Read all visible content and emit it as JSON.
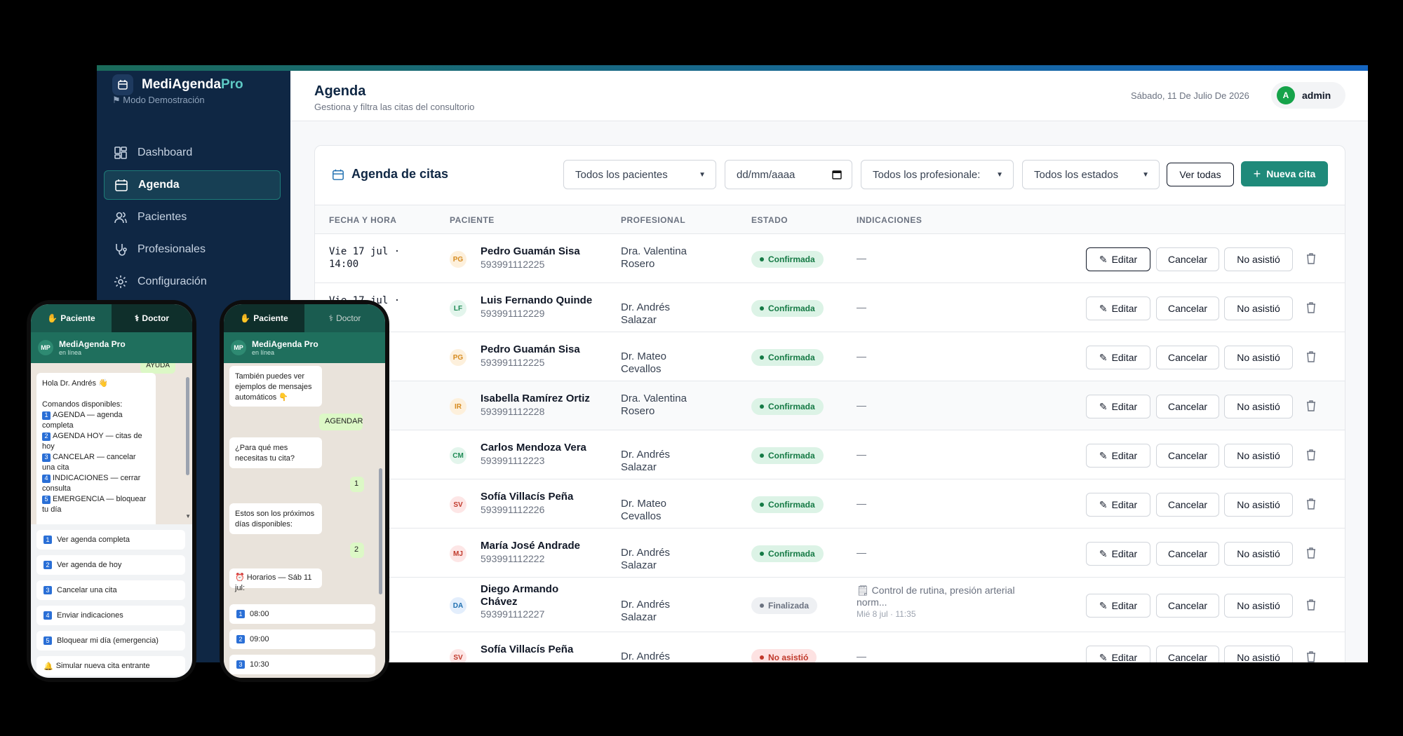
{
  "app": {
    "name": "MediAgenda",
    "name_suffix": "Pro",
    "mode": "Modo Demostración"
  },
  "sidebar": {
    "items": [
      {
        "label": "Dashboard",
        "icon": "dashboard-icon"
      },
      {
        "label": "Agenda",
        "icon": "calendar-icon",
        "active": true
      },
      {
        "label": "Pacientes",
        "icon": "users-icon"
      },
      {
        "label": "Profesionales",
        "icon": "stethoscope-icon"
      },
      {
        "label": "Configuración",
        "icon": "gear-icon"
      }
    ]
  },
  "header": {
    "title": "Agenda",
    "subtitle": "Gestiona y filtra las citas del consultorio",
    "date": "Sábado, 11 De Julio De 2026",
    "user_initial": "A",
    "user_name": "admin"
  },
  "card": {
    "title": "Agenda de citas",
    "filters": {
      "patients": "Todos los pacientes",
      "date_placeholder": "dd/mm/aaaa",
      "professionals": "Todos los profesionale:",
      "states": "Todos los estados"
    },
    "view_all": "Ver todas",
    "new_appointment": "Nueva cita",
    "columns": [
      "FECHA Y HORA",
      "PACIENTE",
      "PROFESIONAL",
      "ESTADO",
      "INDICACIONES"
    ],
    "actions": {
      "edit": "Editar",
      "cancel": "Cancelar",
      "no_show": "No asistió"
    },
    "rows": [
      {
        "date": "Vie 17 jul ·\n14:00",
        "initials": "PG",
        "name": "Pedro Guamán Sisa",
        "phone": "593991112225",
        "professional": "Dra. Valentina Rosero",
        "status": "Confirmada",
        "indication": "—"
      },
      {
        "date": "Vie 17 jul ·",
        "initials": "LF",
        "name": "Luis Fernando Quinde",
        "phone": "593991112229",
        "professional": "Dr. Andrés Salazar",
        "status": "Confirmada",
        "indication": "—"
      },
      {
        "date": "·",
        "initials": "PG",
        "name": "Pedro Guamán Sisa",
        "phone": "593991112225",
        "professional": "Dr. Mateo Cevallos",
        "status": "Confirmada",
        "indication": "—"
      },
      {
        "date": "·",
        "initials": "IR",
        "name": "Isabella Ramírez Ortiz",
        "phone": "593991112228",
        "professional": "Dra. Valentina Rosero",
        "status": "Confirmada",
        "indication": "—"
      },
      {
        "date": "·",
        "initials": "CM",
        "name": "Carlos Mendoza Vera",
        "phone": "593991112223",
        "professional": "Dr. Andrés Salazar",
        "status": "Confirmada",
        "indication": "—"
      },
      {
        "date": "·",
        "initials": "SV",
        "name": "Sofía Villacís Peña",
        "phone": "593991112226",
        "professional": "Dr. Mateo Cevallos",
        "status": "Confirmada",
        "indication": "—"
      },
      {
        "date": "·",
        "initials": "MJ",
        "name": "María José Andrade",
        "phone": "593991112222",
        "professional": "Dr. Andrés Salazar",
        "status": "Confirmada",
        "indication": "—"
      },
      {
        "date": "·",
        "initials": "DA",
        "name": "Diego Armando Chávez",
        "phone": "593991112227",
        "professional": "Dr. Andrés Salazar",
        "status": "Finalizada",
        "indication": "Control de rutina, presión arterial norm...",
        "indication_date": "Mié 8 jul · 11:35"
      },
      {
        "date": "·",
        "initials": "SV",
        "name": "Sofía Villacís Peña",
        "phone": "",
        "professional": "Dr. Andrés Salazar",
        "status": "No asistió",
        "indication": "—"
      }
    ]
  },
  "phone1": {
    "tab_patient": "Paciente",
    "tab_doctor": "Doctor",
    "contact": "MediAgenda Pro",
    "contact_initials": "MP",
    "contact_status": "en línea",
    "cut_top": "AYUDA",
    "message": {
      "greeting": "Hola Dr. Andrés 👋",
      "intro": "Comandos disponibles:",
      "commands": [
        {
          "n": "1",
          "t": "AGENDA — agenda completa"
        },
        {
          "n": "2",
          "t": "AGENDA HOY — citas de hoy"
        },
        {
          "n": "3",
          "t": "CANCELAR — cancelar una cita"
        },
        {
          "n": "4",
          "t": "INDICACIONES — cerrar consulta"
        },
        {
          "n": "5",
          "t": "EMERGENCIA — bloquear tu día"
        }
      ]
    },
    "quick_replies": [
      {
        "n": "1",
        "t": "Ver agenda completa"
      },
      {
        "n": "2",
        "t": "Ver agenda de hoy"
      },
      {
        "n": "3",
        "t": "Cancelar una cita"
      },
      {
        "n": "4",
        "t": "Enviar indicaciones"
      },
      {
        "n": "5",
        "t": "Bloquear mi día (emergencia)"
      },
      {
        "n": "🔔",
        "t": "Simular nueva cita entrante"
      }
    ]
  },
  "phone2": {
    "tab_patient": "Paciente",
    "tab_doctor": "Doctor",
    "contact": "MediAgenda Pro",
    "contact_initials": "MP",
    "contact_status": "en línea",
    "msg1": "También puedes ver ejemplos de mensajes automáticos 👇",
    "msg2": "AGENDAR",
    "msg3": "¿Para qué mes necesitas tu cita?",
    "msg4": "1",
    "msg5": "Estos son los próximos días disponibles:",
    "msg6": "2",
    "msg7": "⏰ Horarios — Sáb 11 jul:",
    "slots": [
      {
        "n": "1",
        "t": "08:00"
      },
      {
        "n": "2",
        "t": "09:00"
      },
      {
        "n": "3",
        "t": "10:30"
      }
    ]
  },
  "colors": {
    "sidebar": "#0f2744",
    "accent": "#1f8a7a",
    "confirm_bg": "#dcf3e6",
    "confirm_fg": "#157a45",
    "final_bg": "#eef0f3",
    "final_fg": "#6b7280",
    "noshow_bg": "#fde2e2",
    "noshow_fg": "#c0392b"
  }
}
